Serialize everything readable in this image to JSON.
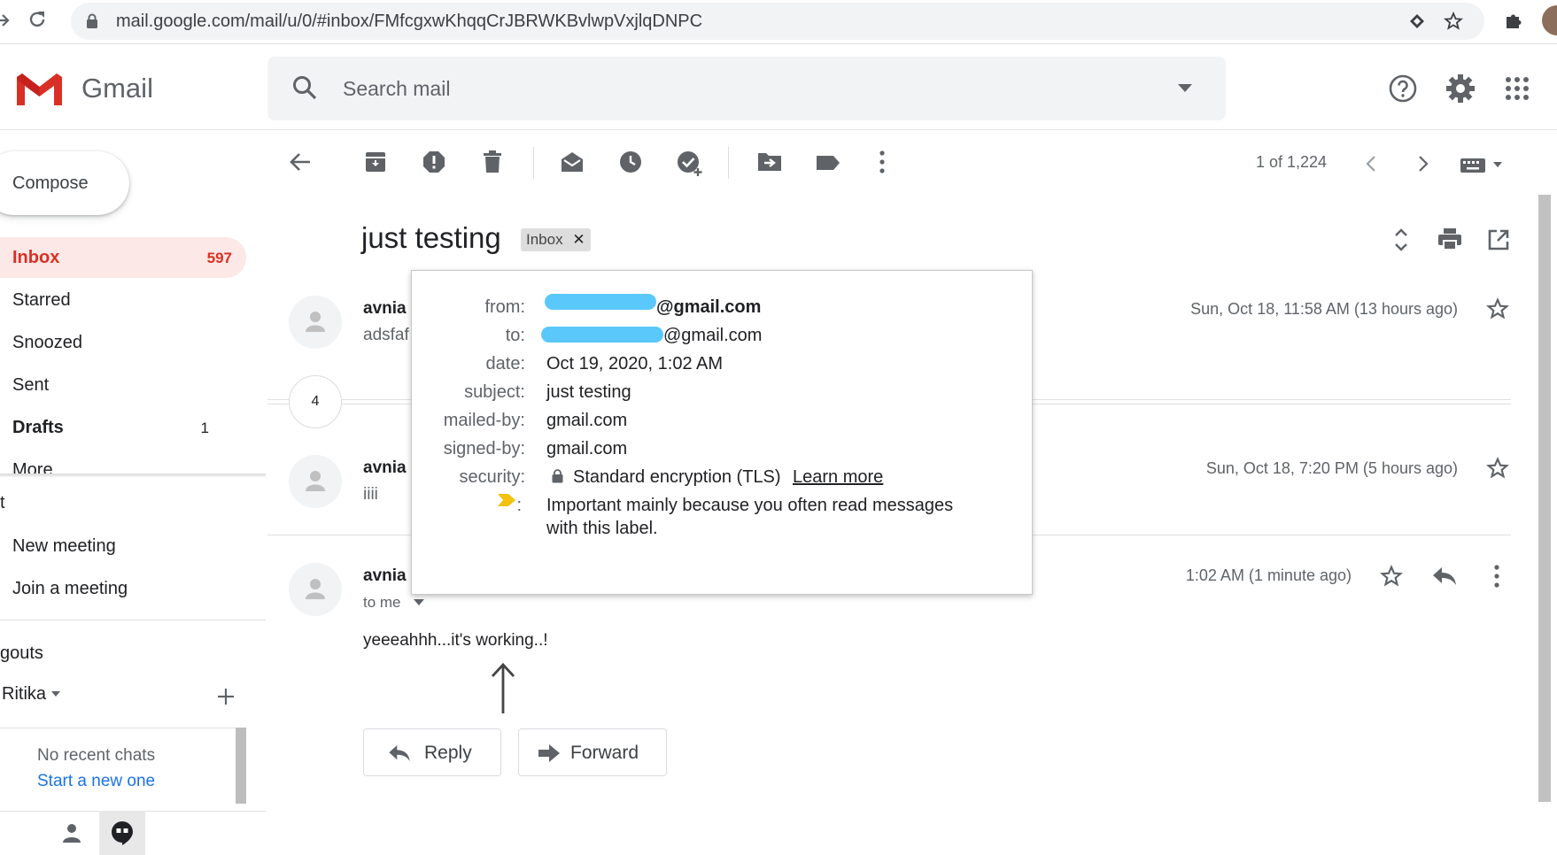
{
  "browser": {
    "url": "mail.google.com/mail/u/0/#inbox/FMfcgxwKhqqCrJBRWKBvlwpVxjlqDNPC"
  },
  "header": {
    "app_title": "Gmail",
    "search_placeholder": "Search mail"
  },
  "sidebar": {
    "compose_label": "Compose",
    "items": [
      {
        "label": "Inbox",
        "count": "597"
      },
      {
        "label": "Starred",
        "count": ""
      },
      {
        "label": "Snoozed",
        "count": ""
      },
      {
        "label": "Sent",
        "count": ""
      },
      {
        "label": "Drafts",
        "count": "1"
      },
      {
        "label": "More",
        "count": ""
      }
    ],
    "meet_title": "t",
    "meet_new": "New meeting",
    "meet_join": "Join a meeting",
    "hangouts_title": "gouts",
    "hangouts_user": "Ritika",
    "no_chats": "No recent chats",
    "start_new": "Start a new one"
  },
  "toolbar": {
    "pagination": "1 of 1,224"
  },
  "thread": {
    "subject": "just testing",
    "label": "Inbox",
    "collapsed_count": "4",
    "messages": [
      {
        "sender": "avnia",
        "snippet": "adsfaf",
        "date": "Sun, Oct 18, 11:58 AM (13 hours ago)"
      },
      {
        "sender": "avnia",
        "snippet": "iiii",
        "date": "Sun, Oct 18, 7:20 PM (5 hours ago)"
      },
      {
        "sender": "avnia",
        "to": "to me",
        "date": "1:02 AM (1 minute ago)",
        "body": "yeeeahhh...it's working..!"
      }
    ],
    "reply_label": "Reply",
    "forward_label": "Forward"
  },
  "details_popup": {
    "from_key": "from:",
    "from_value": "@gmail.com",
    "to_key": "to:",
    "to_value": "@gmail.com",
    "date_key": "date:",
    "date_value": "Oct 19, 2020, 1:02 AM",
    "subject_key": "subject:",
    "subject_value": "just testing",
    "mailed_key": "mailed-by:",
    "mailed_value": "gmail.com",
    "signed_key": "signed-by:",
    "signed_value": "gmail.com",
    "security_key": "security:",
    "security_value": "Standard encryption (TLS)",
    "learn_more": "Learn more",
    "importance_key": ":",
    "importance_line1": "Important mainly because you often read messages",
    "importance_line2": "with this label."
  },
  "colors": {
    "accent_red": "#d93025",
    "link_blue": "#1a73e8",
    "importance_yellow": "#f4c20d"
  }
}
